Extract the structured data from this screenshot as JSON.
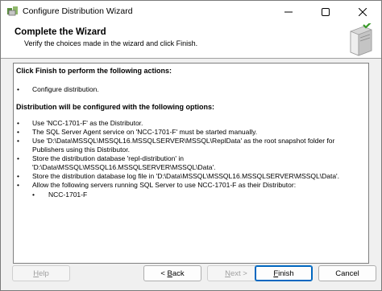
{
  "window": {
    "title": "Configure Distribution Wizard"
  },
  "header": {
    "title": "Complete the Wizard",
    "subtitle": "Verify the choices made in the wizard and click Finish."
  },
  "content": {
    "actions_heading": "Click Finish to perform the following actions:",
    "actions": [
      "Configure distribution."
    ],
    "distribution_heading": "Distribution will be configured with the following options:",
    "options": [
      "Use 'NCC-1701-F' as the Distributor.",
      "The SQL Server Agent service on 'NCC-1701-F' must be started manually.",
      "Use 'D:\\Data\\MSSQL\\MSSQL16.MSSQLSERVER\\MSSQL\\ReplData' as the root snapshot folder for Publishers using this Distributor.",
      "Store the distribution database 'repl-distribution' in 'D:\\Data\\MSSQL\\MSSQL16.MSSQLSERVER\\MSSQL\\Data'.",
      "Store the distribution database log file in 'D:\\Data\\MSSQL\\MSSQL16.MSSQLSERVER\\MSSQL\\Data'.",
      "Allow the following servers running SQL Server to use NCC-1701-F as their Distributor:"
    ],
    "servers": [
      "NCC-1701-F"
    ]
  },
  "buttons": {
    "help": {
      "mnemonic": "H",
      "rest": "elp"
    },
    "back": {
      "prefix": "< ",
      "mnemonic": "B",
      "rest": "ack"
    },
    "next": {
      "mnemonic": "N",
      "rest": "ext >"
    },
    "finish": {
      "mnemonic": "F",
      "rest": "inish"
    },
    "cancel": "Cancel"
  },
  "colors": {
    "accent": "#0067c0",
    "disabled_text": "#a0a0a0"
  },
  "icons": {
    "app": "wizard-app-icon",
    "header": "server-check-icon"
  }
}
